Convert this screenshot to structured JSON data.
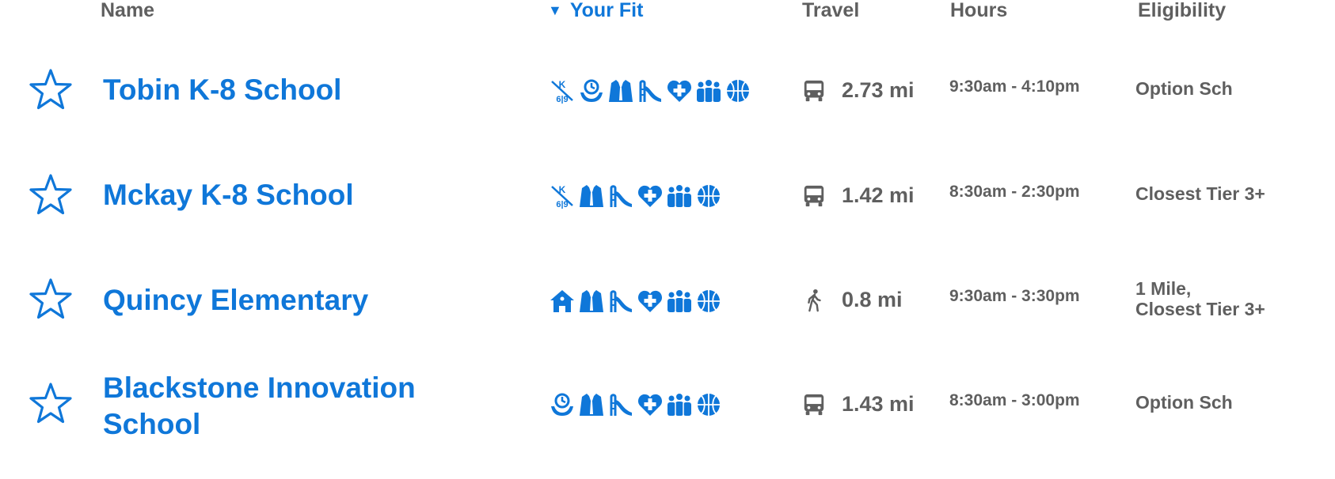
{
  "columns": {
    "name": "Name",
    "fit_caret": "▼",
    "fit": "Your Fit",
    "travel": "Travel",
    "hours": "Hours",
    "eligibility": "Eligibility"
  },
  "colors": {
    "accent": "#0f77d9",
    "text": "#5f5f5f"
  },
  "schools": [
    {
      "name": "Tobin K-8 School",
      "fit_icons": [
        "k8-icon",
        "early-care-icon",
        "uniform-icon",
        "playground-icon",
        "health-icon",
        "family-icon",
        "sports-icon"
      ],
      "travel_mode": "bus-icon",
      "distance": "2.73 mi",
      "hours": "9:30am - 4:10pm",
      "eligibility": "Option Sch"
    },
    {
      "name": "Mckay K-8 School",
      "fit_icons": [
        "k8-icon",
        "uniform-icon",
        "playground-icon",
        "health-icon",
        "family-icon",
        "sports-icon"
      ],
      "travel_mode": "bus-icon",
      "distance": "1.42 mi",
      "hours": "8:30am - 2:30pm",
      "eligibility": "Closest Tier 3+"
    },
    {
      "name": "Quincy Elementary",
      "fit_icons": [
        "school-house-icon",
        "uniform-icon",
        "playground-icon",
        "health-icon",
        "family-icon",
        "sports-icon"
      ],
      "travel_mode": "walk-icon",
      "distance": "0.8 mi",
      "hours": "9:30am - 3:30pm",
      "eligibility": "1 Mile,\nClosest Tier 3+"
    },
    {
      "name": "Blackstone Innovation School",
      "fit_icons": [
        "early-care-icon",
        "uniform-icon",
        "playground-icon",
        "health-icon",
        "family-icon",
        "sports-icon"
      ],
      "travel_mode": "bus-icon",
      "distance": "1.43 mi",
      "hours": "8:30am - 3:00pm",
      "eligibility": "Option Sch"
    }
  ]
}
